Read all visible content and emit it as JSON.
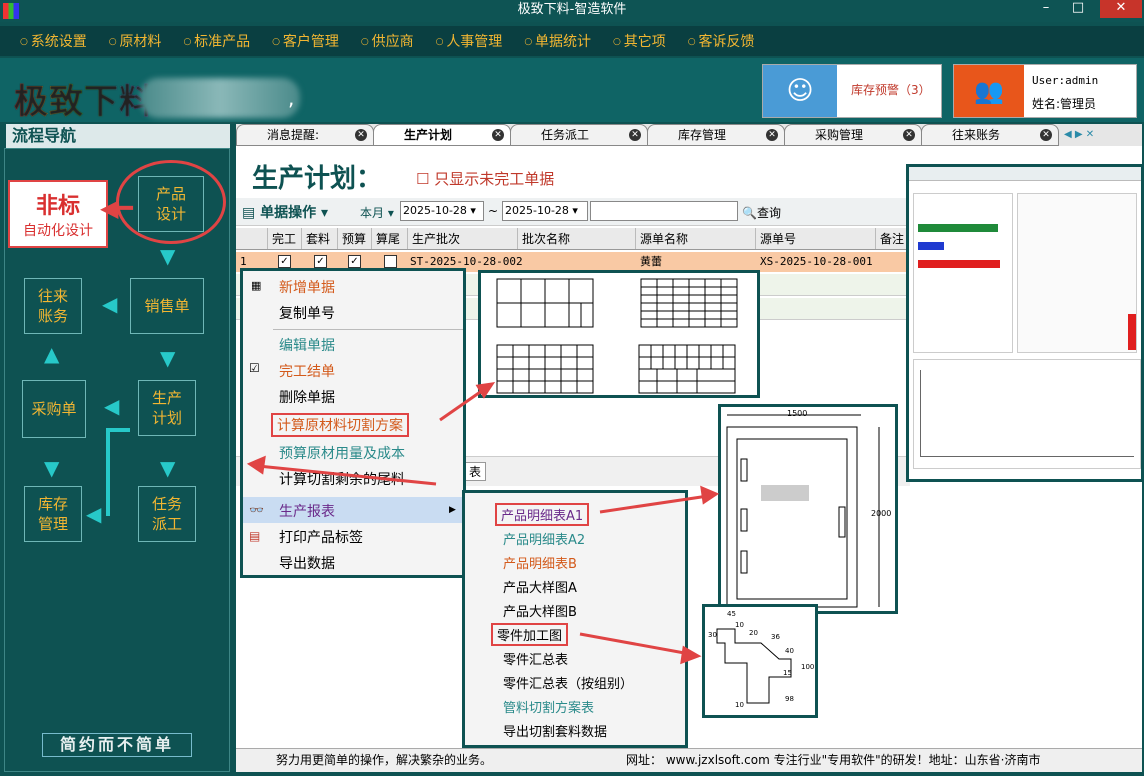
{
  "app": {
    "title": "极致下料-智造软件",
    "min": "–",
    "max": "□",
    "close": "✕"
  },
  "menu": [
    "系统设置",
    "原材料",
    "标准产品",
    "客户管理",
    "供应商",
    "人事管理",
    "单据统计",
    "其它项",
    "客诉反馈"
  ],
  "logo": "极致下料",
  "logo_suffix": ",",
  "alert": {
    "label": "库存预警（3）"
  },
  "user": {
    "login": "User:admin",
    "name": "姓名:管理员"
  },
  "nav": {
    "title": "流程导航",
    "feibiao_line1": "非标",
    "feibiao_line2": "自动化设计",
    "product_design": "产品\n设计",
    "sales_order": "销售单",
    "ar_account": "往来\n账务",
    "production_plan": "生产\n计划",
    "purchase_order": "采购单",
    "stock": "库存\n管理",
    "task_dispatch": "任务\n派工",
    "slogan": "简约而不简单"
  },
  "tabs": [
    {
      "label": "消息提醒:"
    },
    {
      "label": "生产计划"
    },
    {
      "label": "任务派工"
    },
    {
      "label": "库存管理"
    },
    {
      "label": "采购管理"
    },
    {
      "label": "往来账务"
    }
  ],
  "page": {
    "title": "生产计划：",
    "only_undone": "只显示未完工单据"
  },
  "toolbar": {
    "ops": "单据操作",
    "period": "本月",
    "date_from": "2025-10-28",
    "sep": "~",
    "date_to": "2025-10-28",
    "search": "查询"
  },
  "table": {
    "headers": [
      "完工",
      "套料",
      "预算",
      "算尾",
      "生产批次",
      "批次名称",
      "源单名称",
      "源单号",
      "备注"
    ],
    "row1": {
      "index": "1",
      "batch": "ST-2025-10-28-002",
      "source_name": "黄蕾",
      "source_no": "XS-2025-10-28-001"
    }
  },
  "context_menu": [
    "新增单据",
    "复制单号",
    "编辑单据",
    "完工结单",
    "删除单据",
    "计算原材料切割方案",
    "预算原材用量及成本",
    "计算切割剩余的尾料",
    "生产报表",
    "打印产品标签",
    "导出数据"
  ],
  "submenu": [
    "产品明细表A1",
    "产品明细表A2",
    "产品明细表B",
    "产品大样图A",
    "产品大样图B",
    "零件加工图",
    "零件汇总表",
    "零件汇总表（按组别）",
    "管料切割方案表",
    "导出切割套料数据"
  ],
  "drawing": {
    "width": "1500",
    "height": "2000"
  },
  "part": {
    "d1": "45",
    "d2": "10",
    "d3": "20",
    "d4": "36",
    "d5": "30",
    "d6": "40",
    "d7": "15",
    "d8": "100",
    "d9": "10",
    "d10": "98"
  },
  "partial_tab": "表",
  "statusbar": {
    "left": "努力用更简单的操作，解决繁杂的业务。",
    "right": "网址：  www.jzxlsoft.com    专注行业\"专用软件\"的研发！地址：山东省·济南市"
  },
  "colors": {
    "teal": "#0e5252",
    "accent": "#f2b632",
    "red": "#e04444"
  }
}
